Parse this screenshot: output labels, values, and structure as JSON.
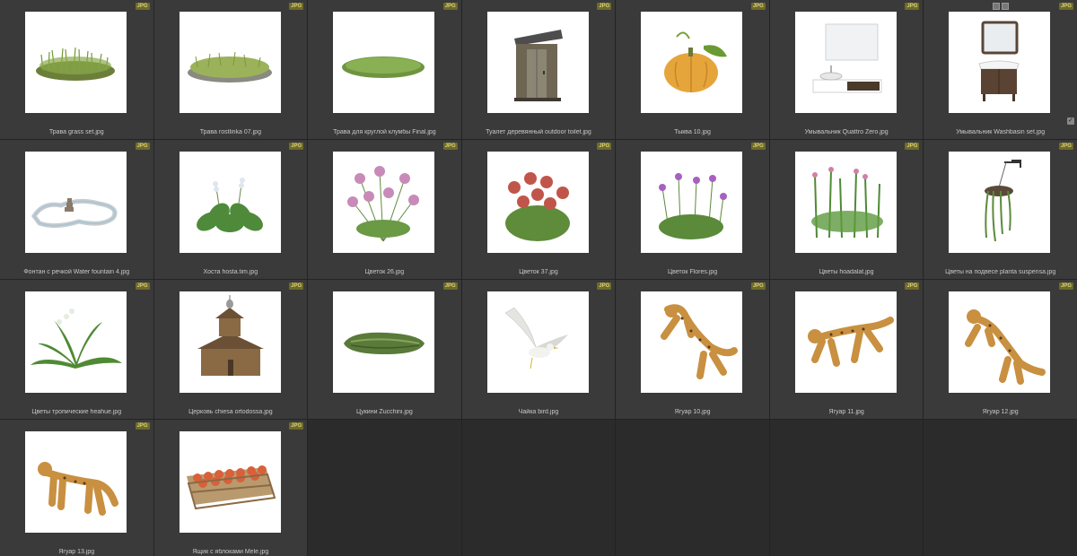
{
  "badge": "JPG",
  "items": [
    {
      "name": "Трава grass set.jpg",
      "icon": "grass-tuft"
    },
    {
      "name": "Трава rostlinka 07.jpg",
      "icon": "grass-patch"
    },
    {
      "name": "Трава для круглой клумбы Final.jpg",
      "icon": "grass-round"
    },
    {
      "name": "Туалет деревянный outdoor toilet.jpg",
      "icon": "outhouse"
    },
    {
      "name": "Тыква 10.jpg",
      "icon": "pumpkin"
    },
    {
      "name": "Умывальник Quattro Zero.jpg",
      "icon": "washbasin-modern"
    },
    {
      "name": "Умывальник Washbasin set.jpg",
      "icon": "washbasin-classic"
    },
    {
      "name": "Фонтан с речкой Water fountain 4.jpg",
      "icon": "fountain"
    },
    {
      "name": "Хоста hosta.tim.jpg",
      "icon": "hosta"
    },
    {
      "name": "Цветок 26.jpg",
      "icon": "flower-pink"
    },
    {
      "name": "Цветок 37.jpg",
      "icon": "flower-red"
    },
    {
      "name": "Цветок Flores.jpg",
      "icon": "flower-purple"
    },
    {
      "name": "Цветы hoadalat.jpg",
      "icon": "flower-stalks"
    },
    {
      "name": "Цветы на подвесе planta suspensa.jpg",
      "icon": "hanging-plant"
    },
    {
      "name": "Цветы тропические heahue.jpg",
      "icon": "tropical-plant"
    },
    {
      "name": "Церковь chiesa ortodossa.jpg",
      "icon": "wooden-church"
    },
    {
      "name": "Цукини Zucchini.jpg",
      "icon": "zucchini"
    },
    {
      "name": "Чайка bird.jpg",
      "icon": "seagull"
    },
    {
      "name": "Ягуар 10.jpg",
      "icon": "jaguar-leap"
    },
    {
      "name": "Ягуар 11.jpg",
      "icon": "jaguar-run"
    },
    {
      "name": "Ягуар 12.jpg",
      "icon": "jaguar-pounce"
    },
    {
      "name": "Ягуар 13.jpg",
      "icon": "jaguar-walk"
    },
    {
      "name": "Ящик с яблоками Mele.jpg",
      "icon": "apple-crate"
    }
  ]
}
